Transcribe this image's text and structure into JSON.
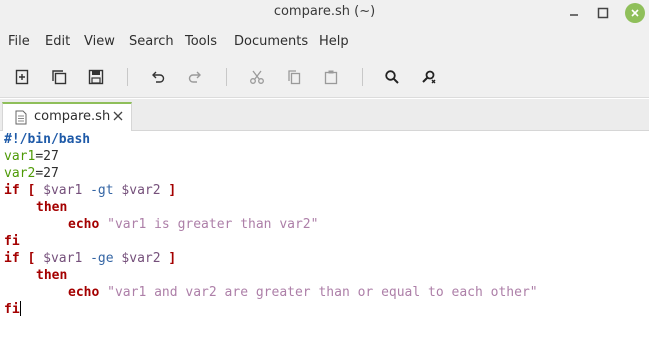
{
  "window": {
    "title": "compare.sh (~)"
  },
  "menu": [
    "File",
    "Edit",
    "View",
    "Search",
    "Tools",
    "Documents",
    "Help"
  ],
  "toolbar": {
    "icons": [
      "new-document-icon",
      "new-window-icon",
      "save-icon",
      "undo-icon",
      "redo-icon",
      "cut-icon",
      "copy-icon",
      "paste-icon",
      "search-icon",
      "tools-icon"
    ]
  },
  "tab": {
    "label": "compare.sh"
  },
  "code": {
    "l1": "#!/bin/bash",
    "l2_name": "var1",
    "l2_val": "=27",
    "l3_name": "var2",
    "l3_val": "=27",
    "l4_if": "if",
    "l4_open": " [ ",
    "l4_a": "$var1",
    "l4_flag": " -gt ",
    "l4_b": "$var2",
    "l4_close": " ]",
    "l5": "then",
    "l6_cmd": "echo",
    "l6_str": "\"var1 is greater than var2\"",
    "l7": "fi",
    "l8_if": "if",
    "l8_open": " [ ",
    "l8_a": "$var1",
    "l8_flag": " -ge ",
    "l8_b": "$var2",
    "l8_close": " ]",
    "l9": "then",
    "l10_cmd": "echo",
    "l10_str": "\"var1 and var2 are greater than or equal to each other\"",
    "l11": "fi"
  }
}
